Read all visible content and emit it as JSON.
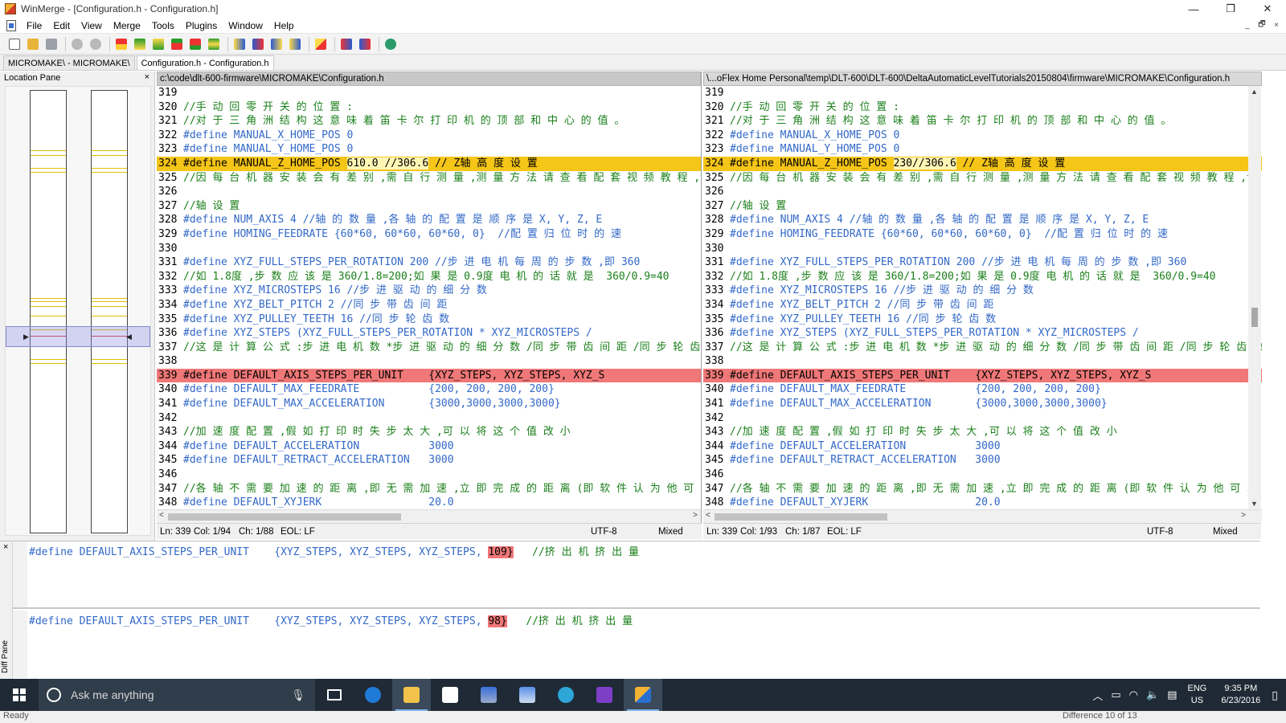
{
  "window": {
    "title": "WinMerge - [Configuration.h - Configuration.h]",
    "minimize": "—",
    "maximize": "❐",
    "close": "✕"
  },
  "menu": {
    "items": [
      "File",
      "Edit",
      "View",
      "Merge",
      "Tools",
      "Plugins",
      "Window",
      "Help"
    ],
    "mdi_min": "_",
    "mdi_restore": "🗗",
    "mdi_close": "×"
  },
  "tabs": [
    {
      "label": "MICROMAKE\\ - MICROMAKE\\",
      "active": false
    },
    {
      "label": "Configuration.h - Configuration.h",
      "active": true
    }
  ],
  "location_pane": {
    "title": "Location Pane",
    "close": "×"
  },
  "left_pane": {
    "path": "c:\\code\\dlt-600-firmware\\MICROMAKE\\Configuration.h",
    "lines": [
      {
        "n": "319",
        "t": "",
        "kind": "normal"
      },
      {
        "n": "320",
        "t": "//手 动 回 零 开 关 的 位 置 :",
        "kind": "normal"
      },
      {
        "n": "321",
        "t": "//对 于 三 角 洲 结 构 这 意 味 着 笛 卡 尔 打 印 机 的 顶 部 和 中 心 的 值 。",
        "kind": "normal"
      },
      {
        "n": "322",
        "t": "#define MANUAL_X_HOME_POS 0",
        "kind": "kw"
      },
      {
        "n": "323",
        "t": "#define MANUAL_Y_HOME_POS 0",
        "kind": "kw"
      },
      {
        "n": "324",
        "t": "#define MANUAL_Z_HOME_POS 610.0 //306.6 // Z轴 高 度 设 置",
        "kind": "diff",
        "hl": "610.0 //306.6"
      },
      {
        "n": "325",
        "t": "//因 每 台 机 器 安 装 会 有 差 别 ,需 自 行 测 量 ,测 量 方 法 请 查 看 配 套 视 频 教 程 ,设 计",
        "kind": "normal"
      },
      {
        "n": "326",
        "t": "",
        "kind": "normal"
      },
      {
        "n": "327",
        "t": "//轴 设 置",
        "kind": "normal"
      },
      {
        "n": "328",
        "t": "#define NUM_AXIS 4 //轴 的 数 量 ,各 轴 的 配 置 是 顺 序 是 X, Y, Z, E",
        "kind": "kw"
      },
      {
        "n": "329",
        "t": "#define HOMING_FEEDRATE {60*60, 60*60, 60*60, 0}  //配 置 归 位 时 的 速",
        "kind": "kw"
      },
      {
        "n": "330",
        "t": "",
        "kind": "normal"
      },
      {
        "n": "331",
        "t": "#define XYZ_FULL_STEPS_PER_ROTATION 200 //步 进 电 机 每 周 的 步 数 ,即 360",
        "kind": "kw"
      },
      {
        "n": "332",
        "t": "//如 1.8度 ,步 数 应 该 是 360/1.8=200;如 果 是 0.9度 电 机 的 话 就 是  360/0.9=40",
        "kind": "normal"
      },
      {
        "n": "333",
        "t": "#define XYZ_MICROSTEPS 16 //步 进 驱 动 的 细 分 数",
        "kind": "kw"
      },
      {
        "n": "334",
        "t": "#define XYZ_BELT_PITCH 2 //同 步 带 齿 间 距",
        "kind": "kw"
      },
      {
        "n": "335",
        "t": "#define XYZ_PULLEY_TEETH 16 //同 步 轮 齿 数",
        "kind": "kw"
      },
      {
        "n": "336",
        "t": "#define XYZ_STEPS (XYZ_FULL_STEPS_PER_ROTATION * XYZ_MICROSTEPS /",
        "kind": "kw"
      },
      {
        "n": "337",
        "t": "//这 是 计 算 公 式 :步 进 电 机 数 *步 进 驱 动 的 细 分 数 /同 步 带 齿 间 距 /同 步 轮 齿 数",
        "kind": "normal"
      },
      {
        "n": "338",
        "t": "",
        "kind": "normal"
      },
      {
        "n": "339",
        "t": "#define DEFAULT_AXIS_STEPS_PER_UNIT    {XYZ_STEPS, XYZ_STEPS, XYZ_S",
        "kind": "sel"
      },
      {
        "n": "340",
        "t": "#define DEFAULT_MAX_FEEDRATE           {200, 200, 200, 200}",
        "kind": "kw"
      },
      {
        "n": "341",
        "t": "#define DEFAULT_MAX_ACCELERATION       {3000,3000,3000,3000}",
        "kind": "kw"
      },
      {
        "n": "342",
        "t": "",
        "kind": "normal"
      },
      {
        "n": "343",
        "t": "//加 速 度 配 置 ,假 如 打 印 时 失 步 太 大 ,可 以 将 这 个 值 改 小",
        "kind": "normal"
      },
      {
        "n": "344",
        "t": "#define DEFAULT_ACCELERATION           3000",
        "kind": "kw"
      },
      {
        "n": "345",
        "t": "#define DEFAULT_RETRACT_ACCELERATION   3000",
        "kind": "kw"
      },
      {
        "n": "346",
        "t": "",
        "kind": "normal"
      },
      {
        "n": "347",
        "t": "//各 轴 不 需 要 加 速 的 距 离 ,即 无 需 加 速 ,立 即 完 成 的 距 离 (即 软 件 认 为 他 可 以 :",
        "kind": "normal"
      },
      {
        "n": "348",
        "t": "#define DEFAULT_XYJERK                 20.0",
        "kind": "kw"
      }
    ],
    "status": {
      "ln": "Ln: 339",
      "col": "Col: 1/94",
      "ch": "Ch: 1/88",
      "eol": "EOL: LF",
      "enc": "UTF-8",
      "mode": "Mixed"
    }
  },
  "right_pane": {
    "path": "\\...oFlex Home Personal\\temp\\DLT-600\\DLT-600\\DeltaAutomaticLevelTutorials20150804\\firmware\\MICROMAKE\\Configuration.h",
    "lines": [
      {
        "n": "319",
        "t": "",
        "kind": "normal"
      },
      {
        "n": "320",
        "t": "//手 动 回 零 开 关 的 位 置 :",
        "kind": "normal"
      },
      {
        "n": "321",
        "t": "//对 于 三 角 洲 结 构 这 意 味 着 笛 卡 尔 打 印 机 的 顶 部 和 中 心 的 值 。",
        "kind": "normal"
      },
      {
        "n": "322",
        "t": "#define MANUAL_X_HOME_POS 0",
        "kind": "kw"
      },
      {
        "n": "323",
        "t": "#define MANUAL_Y_HOME_POS 0",
        "kind": "kw"
      },
      {
        "n": "324",
        "t": "#define MANUAL_Z_HOME_POS 230//306.6 // Z轴 高 度 设 置",
        "kind": "diff",
        "hl": "230//306.6"
      },
      {
        "n": "325",
        "t": "//因 每 台 机 器 安 装 会 有 差 别 ,需 自 行 测 量 ,测 量 方 法 请 查 看 配 套 视 频 教 程 ,设 计",
        "kind": "normal"
      },
      {
        "n": "326",
        "t": "",
        "kind": "normal"
      },
      {
        "n": "327",
        "t": "//轴 设 置",
        "kind": "normal"
      },
      {
        "n": "328",
        "t": "#define NUM_AXIS 4 //轴 的 数 量 ,各 轴 的 配 置 是 顺 序 是 X, Y, Z, E",
        "kind": "kw"
      },
      {
        "n": "329",
        "t": "#define HOMING_FEEDRATE {60*60, 60*60, 60*60, 0}  //配 置 归 位 时 的 速",
        "kind": "kw"
      },
      {
        "n": "330",
        "t": "",
        "kind": "normal"
      },
      {
        "n": "331",
        "t": "#define XYZ_FULL_STEPS_PER_ROTATION 200 //步 进 电 机 每 周 的 步 数 ,即 360",
        "kind": "kw"
      },
      {
        "n": "332",
        "t": "//如 1.8度 ,步 数 应 该 是 360/1.8=200;如 果 是 0.9度 电 机 的 话 就 是  360/0.9=40",
        "kind": "normal"
      },
      {
        "n": "333",
        "t": "#define XYZ_MICROSTEPS 16 //步 进 驱 动 的 细 分 数",
        "kind": "kw"
      },
      {
        "n": "334",
        "t": "#define XYZ_BELT_PITCH 2 //同 步 带 齿 间 距",
        "kind": "kw"
      },
      {
        "n": "335",
        "t": "#define XYZ_PULLEY_TEETH 16 //同 步 轮 齿 数",
        "kind": "kw"
      },
      {
        "n": "336",
        "t": "#define XYZ_STEPS (XYZ_FULL_STEPS_PER_ROTATION * XYZ_MICROSTEPS /",
        "kind": "kw"
      },
      {
        "n": "337",
        "t": "//这 是 计 算 公 式 :步 进 电 机 数 *步 进 驱 动 的 细 分 数 /同 步 带 齿 间 距 /同 步 轮 齿 数",
        "kind": "normal"
      },
      {
        "n": "338",
        "t": "",
        "kind": "normal"
      },
      {
        "n": "339",
        "t": "#define DEFAULT_AXIS_STEPS_PER_UNIT    {XYZ_STEPS, XYZ_STEPS, XYZ_S",
        "kind": "sel"
      },
      {
        "n": "340",
        "t": "#define DEFAULT_MAX_FEEDRATE           {200, 200, 200, 200}",
        "kind": "kw"
      },
      {
        "n": "341",
        "t": "#define DEFAULT_MAX_ACCELERATION       {3000,3000,3000,3000}",
        "kind": "kw"
      },
      {
        "n": "342",
        "t": "",
        "kind": "normal"
      },
      {
        "n": "343",
        "t": "//加 速 度 配 置 ,假 如 打 印 时 失 步 太 大 ,可 以 将 这 个 值 改 小",
        "kind": "normal"
      },
      {
        "n": "344",
        "t": "#define DEFAULT_ACCELERATION           3000",
        "kind": "kw"
      },
      {
        "n": "345",
        "t": "#define DEFAULT_RETRACT_ACCELERATION   3000",
        "kind": "kw"
      },
      {
        "n": "346",
        "t": "",
        "kind": "normal"
      },
      {
        "n": "347",
        "t": "//各 轴 不 需 要 加 速 的 距 离 ,即 无 需 加 速 ,立 即 完 成 的 距 离 (即 软 件 认 为 他 可 以 :",
        "kind": "normal"
      },
      {
        "n": "348",
        "t": "#define DEFAULT_XYJERK                 20.0",
        "kind": "kw"
      }
    ],
    "status": {
      "ln": "Ln: 339",
      "col": "Col: 1/93",
      "ch": "Ch: 1/87",
      "eol": "EOL: LF",
      "enc": "UTF-8",
      "mode": "Mixed"
    }
  },
  "diff_pane": {
    "label": "Diff Pane",
    "close": "×",
    "top_prefix": "#define DEFAULT_AXIS_STEPS_PER_UNIT    {XYZ_STEPS, XYZ_STEPS, XYZ_STEPS, ",
    "top_value": "109}",
    "top_comment": "   //挤 出 机 挤 出 量",
    "bottom_prefix": "#define DEFAULT_AXIS_STEPS_PER_UNIT    {XYZ_STEPS, XYZ_STEPS, XYZ_STEPS, ",
    "bottom_value": "98}",
    "bottom_comment": "   //挤 出 机 挤 出 量"
  },
  "taskbar": {
    "search_placeholder": "Ask me anything",
    "lang_top": "ENG",
    "lang_bottom": "US",
    "time": "9:35 PM",
    "date": "6/23/2016"
  },
  "app_status": {
    "left": "Ready",
    "right": "Difference 10 of 13"
  },
  "colors": {
    "diff_line": "#f5c518",
    "selected_diff": "#f07878",
    "keyword": "#3268c8",
    "comment": "#1a7f1a"
  }
}
